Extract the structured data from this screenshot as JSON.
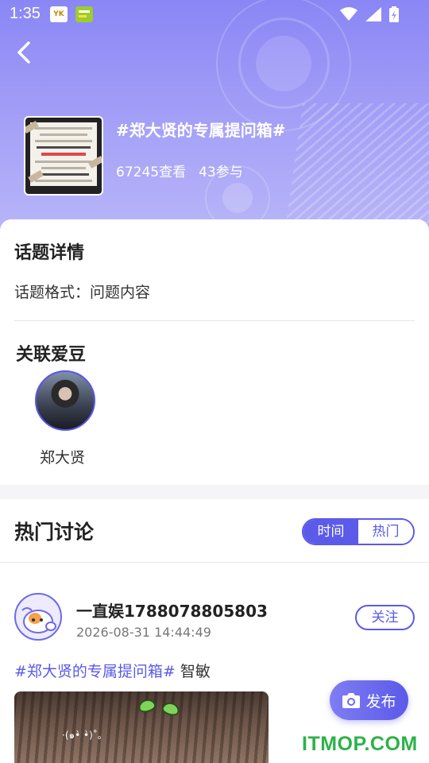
{
  "status_bar": {
    "time": "1:35",
    "app_icon_1": "YK",
    "app_icon_2": "app-icon"
  },
  "header": {
    "back_icon": "chevron-left-icon",
    "topic_title": "#郑大贤的专属提问箱#",
    "views": "67245查看",
    "participants": "43参与"
  },
  "details": {
    "title": "话题详情",
    "format_text": "话题格式：问题内容"
  },
  "related": {
    "title": "关联爱豆",
    "idol_name": "郑大贤"
  },
  "hot": {
    "title": "热门讨论",
    "tabs": [
      {
        "label": "时间",
        "active": true
      },
      {
        "label": "热门",
        "active": false
      }
    ]
  },
  "post": {
    "username": "一直娱1788078805803",
    "time": "2026-08-31 14:44:49",
    "follow_label": "关注",
    "tag": "#郑大贤的专属提问箱#",
    "text": " 智敏"
  },
  "publish": {
    "label": "发布",
    "icon": "camera-icon"
  },
  "watermark": "ITMOP.COM",
  "colors": {
    "accent": "#5b5ae9",
    "header_start": "#8a86f5",
    "watermark": "#2db24a"
  }
}
